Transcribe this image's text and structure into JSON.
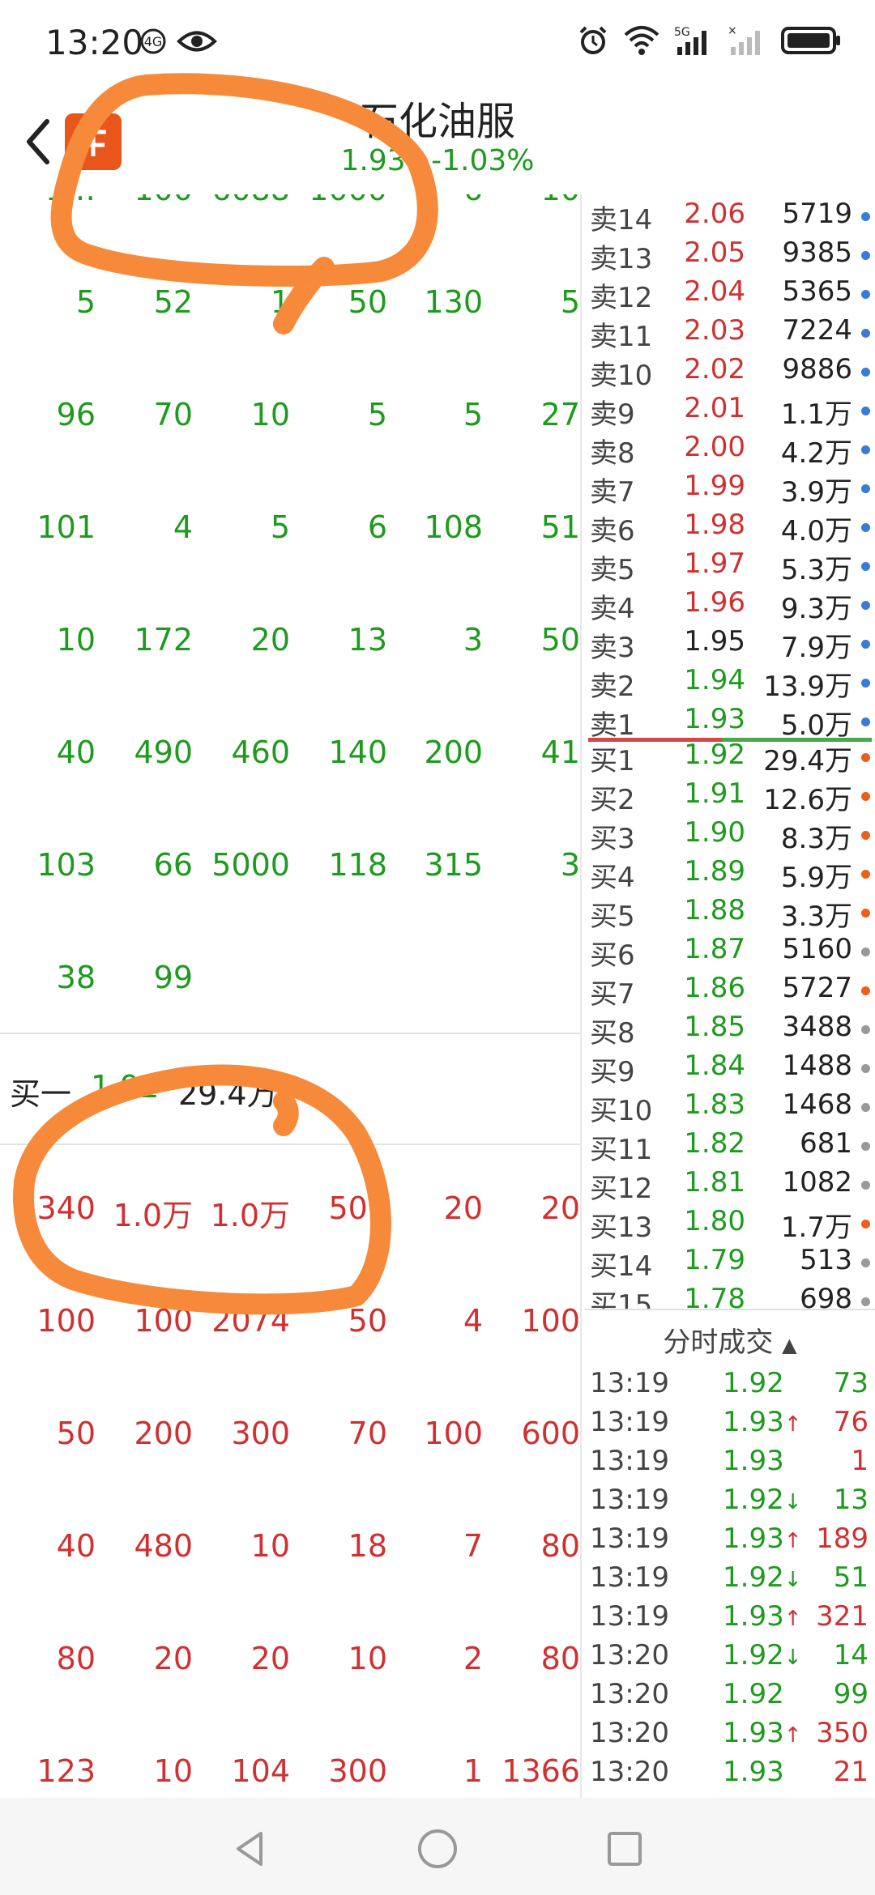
{
  "status_bar": {
    "time": "13:20",
    "icons": [
      "hd-icon",
      "eye-icon",
      "alarm-icon",
      "wifi-icon",
      "signal-5g-icon",
      "signal-icon",
      "battery-icon"
    ]
  },
  "header": {
    "stock_name": "石化油服",
    "price": "1.93",
    "change_pct": "-1.03%",
    "logo_text": "东方财富"
  },
  "sell_queue_rows": [
    [
      "1…",
      "100",
      "6088",
      "1000",
      "6",
      "10"
    ],
    [
      "5",
      "52",
      "1",
      "50",
      "130",
      "5"
    ],
    [
      "96",
      "70",
      "10",
      "5",
      "5",
      "27"
    ],
    [
      "101",
      "4",
      "5",
      "6",
      "108",
      "51"
    ],
    [
      "10",
      "172",
      "20",
      "13",
      "3",
      "50"
    ],
    [
      "40",
      "490",
      "460",
      "140",
      "200",
      "41"
    ],
    [
      "103",
      "66",
      "5000",
      "118",
      "315",
      "3"
    ],
    [
      "38",
      "99",
      "",
      "",
      "",
      ""
    ]
  ],
  "buy_one": {
    "label": "买一",
    "price": "1.92",
    "volume": "29.4万"
  },
  "buy_queue_rows": [
    [
      "1340",
      "1.0万",
      "1.0万",
      "500",
      "20",
      "20"
    ],
    [
      "100",
      "100",
      "2074",
      "50",
      "4",
      "100"
    ],
    [
      "50",
      "200",
      "300",
      "70",
      "100",
      "600"
    ],
    [
      "40",
      "480",
      "10",
      "18",
      "7",
      "80"
    ],
    [
      "80",
      "20",
      "20",
      "10",
      "2",
      "80"
    ],
    [
      "123",
      "10",
      "104",
      "300",
      "1",
      "1366"
    ]
  ],
  "order_book": {
    "asks": [
      {
        "label": "卖14",
        "price": "2.06",
        "vol": "5719",
        "color": "#d03030",
        "dot": "#3a7bd5"
      },
      {
        "label": "卖13",
        "price": "2.05",
        "vol": "9385",
        "color": "#d03030",
        "dot": "#3a7bd5"
      },
      {
        "label": "卖12",
        "price": "2.04",
        "vol": "5365",
        "color": "#d03030",
        "dot": "#3a7bd5"
      },
      {
        "label": "卖11",
        "price": "2.03",
        "vol": "7224",
        "color": "#d03030",
        "dot": "#3a7bd5"
      },
      {
        "label": "卖10",
        "price": "2.02",
        "vol": "9886",
        "color": "#d03030",
        "dot": "#3a7bd5"
      },
      {
        "label": "卖9",
        "price": "2.01",
        "vol": "1.1万",
        "color": "#d03030",
        "dot": "#3a7bd5"
      },
      {
        "label": "卖8",
        "price": "2.00",
        "vol": "4.2万",
        "color": "#d03030",
        "dot": "#3a7bd5"
      },
      {
        "label": "卖7",
        "price": "1.99",
        "vol": "3.9万",
        "color": "#d03030",
        "dot": "#3a7bd5"
      },
      {
        "label": "卖6",
        "price": "1.98",
        "vol": "4.0万",
        "color": "#d03030",
        "dot": "#3a7bd5"
      },
      {
        "label": "卖5",
        "price": "1.97",
        "vol": "5.3万",
        "color": "#d03030",
        "dot": "#3a7bd5"
      },
      {
        "label": "卖4",
        "price": "1.96",
        "vol": "9.3万",
        "color": "#d03030",
        "dot": "#3a7bd5"
      },
      {
        "label": "卖3",
        "price": "1.95",
        "vol": "7.9万",
        "color": "#222222",
        "dot": "#3a7bd5"
      },
      {
        "label": "卖2",
        "price": "1.94",
        "vol": "13.9万",
        "color": "#1e9a1e",
        "dot": "#3a7bd5"
      },
      {
        "label": "卖1",
        "price": "1.93",
        "vol": "5.0万",
        "color": "#1e9a1e",
        "dot": "#3a7bd5"
      }
    ],
    "bids": [
      {
        "label": "买1",
        "price": "1.92",
        "vol": "29.4万",
        "color": "#1e9a1e",
        "dot": "#e8601c"
      },
      {
        "label": "买2",
        "price": "1.91",
        "vol": "12.6万",
        "color": "#1e9a1e",
        "dot": "#e8601c"
      },
      {
        "label": "买3",
        "price": "1.90",
        "vol": "8.3万",
        "color": "#1e9a1e",
        "dot": "#e8601c"
      },
      {
        "label": "买4",
        "price": "1.89",
        "vol": "5.9万",
        "color": "#1e9a1e",
        "dot": "#e8601c"
      },
      {
        "label": "买5",
        "price": "1.88",
        "vol": "3.3万",
        "color": "#1e9a1e",
        "dot": "#e8601c"
      },
      {
        "label": "买6",
        "price": "1.87",
        "vol": "5160",
        "color": "#1e9a1e",
        "dot": "#999999"
      },
      {
        "label": "买7",
        "price": "1.86",
        "vol": "5727",
        "color": "#1e9a1e",
        "dot": "#e8601c"
      },
      {
        "label": "买8",
        "price": "1.85",
        "vol": "3488",
        "color": "#1e9a1e",
        "dot": "#999999"
      },
      {
        "label": "买9",
        "price": "1.84",
        "vol": "1488",
        "color": "#1e9a1e",
        "dot": "#999999"
      },
      {
        "label": "买10",
        "price": "1.83",
        "vol": "1468",
        "color": "#1e9a1e",
        "dot": "#999999"
      },
      {
        "label": "买11",
        "price": "1.82",
        "vol": "681",
        "color": "#1e9a1e",
        "dot": "#999999"
      },
      {
        "label": "买12",
        "price": "1.81",
        "vol": "1082",
        "color": "#1e9a1e",
        "dot": "#999999"
      },
      {
        "label": "买13",
        "price": "1.80",
        "vol": "1.7万",
        "color": "#1e9a1e",
        "dot": "#e8601c"
      },
      {
        "label": "买14",
        "price": "1.79",
        "vol": "513",
        "color": "#1e9a1e",
        "dot": "#999999"
      },
      {
        "label": "买15",
        "price": "1.78",
        "vol": "698",
        "color": "#1e9a1e",
        "dot": "#999999"
      }
    ]
  },
  "trades": {
    "title": "分时成交",
    "rows": [
      {
        "time": "13:19",
        "price": "1.92",
        "arrow": "",
        "vol": "73",
        "color": "#1e9a1e",
        "arrow_color": "#1e9a1e",
        "vol_color": "#1e9a1e"
      },
      {
        "time": "13:19",
        "price": "1.93",
        "arrow": "↑",
        "vol": "76",
        "color": "#1e9a1e",
        "arrow_color": "#d03030",
        "vol_color": "#d03030"
      },
      {
        "time": "13:19",
        "price": "1.93",
        "arrow": "",
        "vol": "1",
        "color": "#1e9a1e",
        "arrow_color": "#d03030",
        "vol_color": "#d03030"
      },
      {
        "time": "13:19",
        "price": "1.92",
        "arrow": "↓",
        "vol": "13",
        "color": "#1e9a1e",
        "arrow_color": "#1e9a1e",
        "vol_color": "#1e9a1e"
      },
      {
        "time": "13:19",
        "price": "1.93",
        "arrow": "↑",
        "vol": "189",
        "color": "#1e9a1e",
        "arrow_color": "#d03030",
        "vol_color": "#d03030"
      },
      {
        "time": "13:19",
        "price": "1.92",
        "arrow": "↓",
        "vol": "51",
        "color": "#1e9a1e",
        "arrow_color": "#1e9a1e",
        "vol_color": "#1e9a1e"
      },
      {
        "time": "13:19",
        "price": "1.93",
        "arrow": "↑",
        "vol": "321",
        "color": "#1e9a1e",
        "arrow_color": "#d03030",
        "vol_color": "#d03030"
      },
      {
        "time": "13:20",
        "price": "1.92",
        "arrow": "↓",
        "vol": "14",
        "color": "#1e9a1e",
        "arrow_color": "#1e9a1e",
        "vol_color": "#1e9a1e"
      },
      {
        "time": "13:20",
        "price": "1.92",
        "arrow": "",
        "vol": "99",
        "color": "#1e9a1e",
        "arrow_color": "#1e9a1e",
        "vol_color": "#1e9a1e"
      },
      {
        "time": "13:20",
        "price": "1.93",
        "arrow": "↑",
        "vol": "350",
        "color": "#1e9a1e",
        "arrow_color": "#d03030",
        "vol_color": "#d03030"
      },
      {
        "time": "13:20",
        "price": "1.93",
        "arrow": "",
        "vol": "21",
        "color": "#1e9a1e",
        "arrow_color": "#d03030",
        "vol_color": "#d03030"
      }
    ]
  },
  "nav_bar": {
    "icons": [
      "back-triangle-icon",
      "home-circle-icon",
      "recents-square-icon"
    ]
  },
  "colors": {
    "up": "#d03030",
    "down": "#1e9a1e",
    "annotation": "#f68a3a"
  }
}
